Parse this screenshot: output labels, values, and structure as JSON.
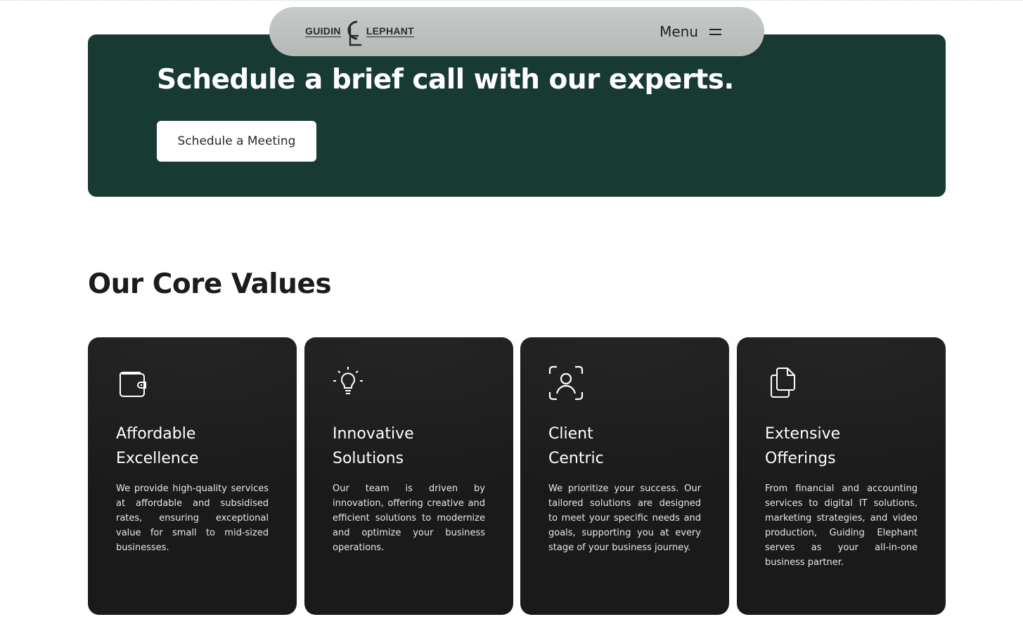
{
  "nav": {
    "logo_left": "GUIDIN",
    "logo_right": "LEPHANT",
    "menu_label": "Menu"
  },
  "cta": {
    "title": "Schedule a brief call with our experts.",
    "button_label": "Schedule a Meeting"
  },
  "core_values": {
    "title": "Our Core Values",
    "cards": [
      {
        "icon": "wallet-icon",
        "title_line1": "Affordable",
        "title_line2": "Excellence",
        "text": "We provide high-quality services at affordable and subsidised rates, ensuring exceptional value for small to mid-sized businesses."
      },
      {
        "icon": "lightbulb-icon",
        "title_line1": "Innovative",
        "title_line2": "Solutions",
        "text": "Our team is driven by innovation, offering creative and efficient solutions to modernize and optimize your business operations."
      },
      {
        "icon": "user-focus-icon",
        "title_line1": "Client",
        "title_line2": "Centric",
        "text": "We prioritize your success. Our tailored solutions are designed to meet your specific needs and goals, supporting you at every stage of your business journey."
      },
      {
        "icon": "copy-documents-icon",
        "title_line1": "Extensive",
        "title_line2": "Offerings",
        "text": "From financial and accounting services to digital IT solutions, marketing strategies, and video production, Guiding Elephant serves as your all-in-one business partner."
      }
    ]
  },
  "colors": {
    "cta_background": "#173a33",
    "card_background": "#1f1f1f",
    "nav_background": "#bfc3c1"
  }
}
